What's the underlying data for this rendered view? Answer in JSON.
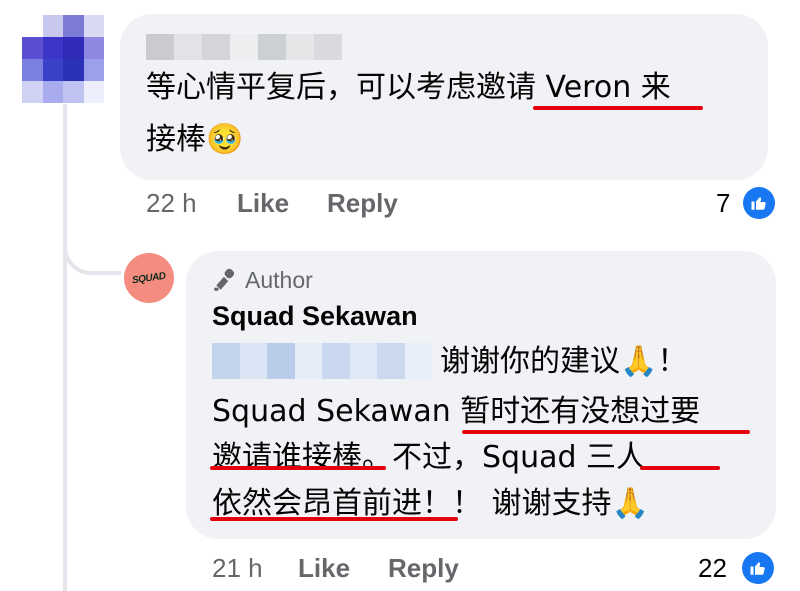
{
  "comment1": {
    "text_line1": "等心情平复后，可以考虑邀请 Veron 来",
    "text_line2": "接棒",
    "emoji": "🥹",
    "time": "22 h",
    "like_label": "Like",
    "reply_label": "Reply",
    "reaction_count": "7"
  },
  "reply": {
    "author_label": "Author",
    "author_name": "Squad Sekawan",
    "avatar_text": "SQUAD",
    "line1_after_mention": "谢谢你的建议",
    "line1_emoji": "🙏",
    "line1_end": "！",
    "line2": "Squad Sekawan 暂时还有没想过要",
    "line3": "邀请谁接棒。不过，Squad  三人",
    "line4": "依然会昂首前进！！ 谢谢支持",
    "line4_emoji": "🙏",
    "time": "21 h",
    "like_label": "Like",
    "reply_label": "Reply",
    "reaction_count": "22"
  },
  "colors": {
    "bubble": "#f0f2f5",
    "meta_text": "#65676b",
    "like_blue": "#1877f2",
    "underline_red": "#e4000f",
    "thread_line": "#e4e6eb"
  },
  "icons": {
    "like_badge": "thumbs-up-icon",
    "author_badge": "microphone-icon"
  }
}
